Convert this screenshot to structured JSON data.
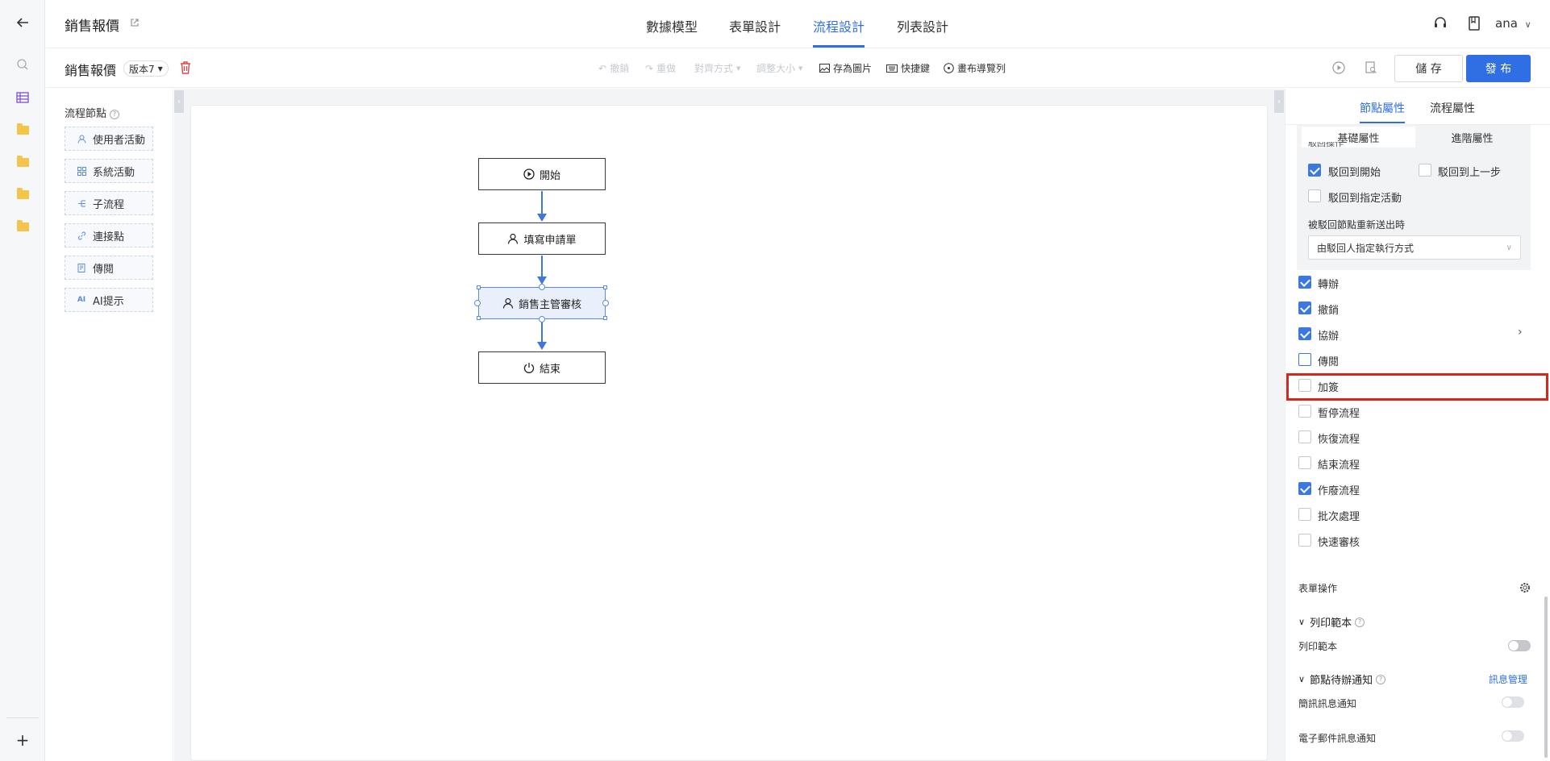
{
  "app": {
    "title": "銷售報價",
    "user": "ana"
  },
  "nav_tabs": [
    {
      "label": "數據模型",
      "active": false
    },
    {
      "label": "表單設計",
      "active": false
    },
    {
      "label": "流程設計",
      "active": true
    },
    {
      "label": "列表設計",
      "active": false
    }
  ],
  "toolbar": {
    "process_name": "銷售報價",
    "version": "版本7",
    "undo": "撤銷",
    "redo": "重做",
    "align": "對齊方式",
    "resize": "調整大小",
    "save_image": "存為圖片",
    "shortcuts": "快捷鍵",
    "canvas_nav": "畫布導覽列",
    "save": "儲 存",
    "publish": "發 布"
  },
  "palette": {
    "title": "流程節點",
    "items": [
      {
        "label": "使用者活動",
        "icon": "user-icon"
      },
      {
        "label": "系統活動",
        "icon": "grid-icon"
      },
      {
        "label": "子流程",
        "icon": "subprocess-icon"
      },
      {
        "label": "連接點",
        "icon": "link-icon"
      },
      {
        "label": "傳閱",
        "icon": "document-icon"
      },
      {
        "label": "AI提示",
        "icon": "ai-icon"
      }
    ]
  },
  "flow": {
    "nodes": [
      {
        "label": "開始",
        "icon": "play-circle-icon"
      },
      {
        "label": "填寫申請單",
        "icon": "user-icon"
      },
      {
        "label": "銷售主管審核",
        "icon": "user-icon",
        "selected": true
      },
      {
        "label": "結束",
        "icon": "power-icon"
      }
    ]
  },
  "panel": {
    "tabs": [
      {
        "label": "節點屬性",
        "active": true
      },
      {
        "label": "流程屬性",
        "active": false
      }
    ],
    "subtabs": [
      {
        "label": "基礎屬性",
        "active": true
      },
      {
        "label": "進階屬性",
        "active": false
      }
    ],
    "reject": {
      "heading": "駁回操作",
      "opt_start": "駁回到開始",
      "opt_start_checked": true,
      "opt_prev": "駁回到上一步",
      "opt_prev_checked": false,
      "opt_specified": "駁回到指定活動",
      "opt_specified_checked": false,
      "resubmit_label": "被駁回節點重新送出時",
      "resubmit_value": "由駁回人指定執行方式"
    },
    "operations": [
      {
        "label": "轉辦",
        "checked": true
      },
      {
        "label": "撤銷",
        "checked": true
      },
      {
        "label": "協辦",
        "checked": true,
        "has_arrow": true
      },
      {
        "label": "傳閱",
        "checked": false
      },
      {
        "label": "加簽",
        "checked": false,
        "highlighted": true
      },
      {
        "label": "暫停流程",
        "checked": false
      },
      {
        "label": "恢復流程",
        "checked": false
      },
      {
        "label": "結束流程",
        "checked": false
      },
      {
        "label": "作廢流程",
        "checked": true
      },
      {
        "label": "批次處理",
        "checked": false
      },
      {
        "label": "快速審核",
        "checked": false
      }
    ],
    "form_ops": "表單操作",
    "print_section": "列印範本",
    "print_toggle_label": "列印範本",
    "notify_section": "節點待辦通知",
    "notify_link": "訊息管理",
    "sms_label": "簡訊訊息通知",
    "email_label": "電子郵件訊息通知"
  },
  "colors": {
    "accent": "#2f6fe3",
    "highlight": "#d9261c"
  }
}
